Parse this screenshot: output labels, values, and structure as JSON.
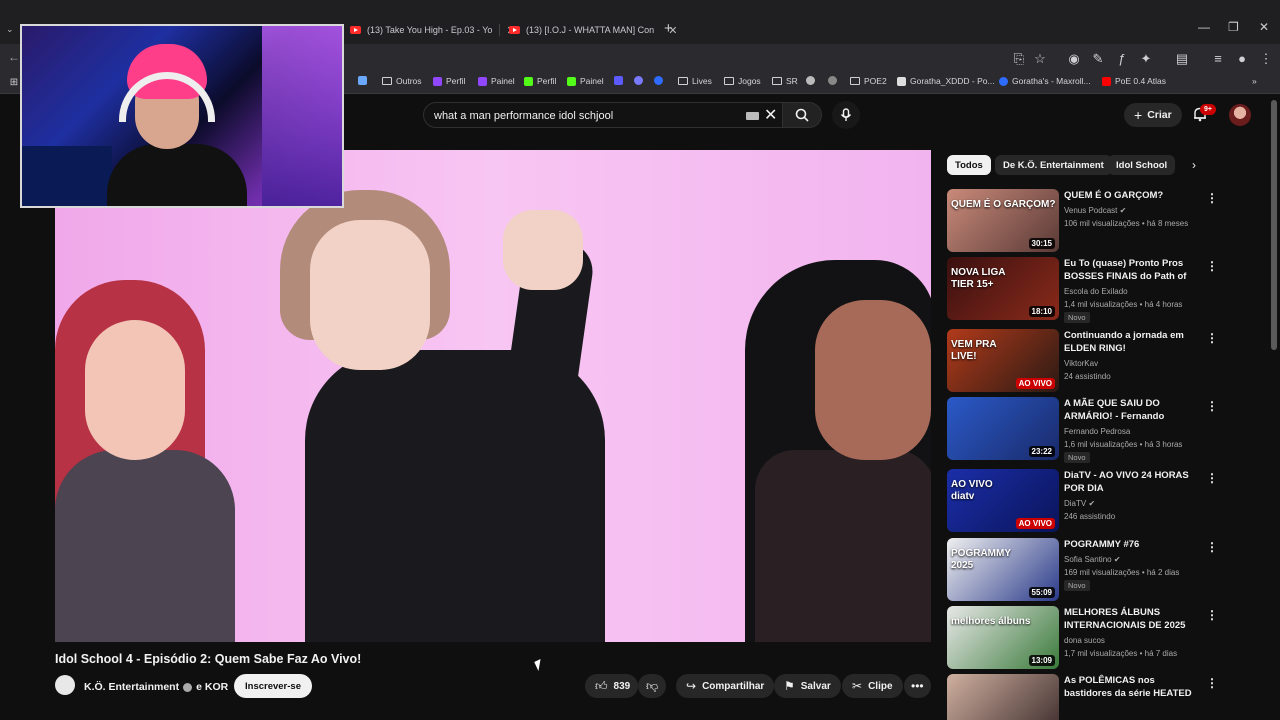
{
  "browser": {
    "tabs": [
      {
        "label": "(13) Take You High - Ep.03 - Yo"
      },
      {
        "label": "(13) [I.O.J - WHATTA MAN] Con"
      }
    ],
    "new_tab": "+",
    "window_controls": [
      "—",
      "❐",
      "✕"
    ],
    "bookmarks": [
      {
        "label": "Outros",
        "icon": "folder-icon"
      },
      {
        "label": "Perfil",
        "icon": "twitch-icon",
        "color": "#9146ff"
      },
      {
        "label": "Painel",
        "icon": "twitch-icon",
        "color": "#9146ff"
      },
      {
        "label": "Perfil",
        "icon": "kick-icon",
        "color": "#53fc18"
      },
      {
        "label": "Painel",
        "icon": "kick-icon",
        "color": "#53fc18"
      },
      {
        "label": "Lives",
        "icon": "folder-icon"
      },
      {
        "label": "Jogos",
        "icon": "folder-icon"
      },
      {
        "label": "SR",
        "icon": "folder-icon"
      },
      {
        "label": "POE2",
        "icon": "folder-icon"
      },
      {
        "label": "Goratha_XDDD - Po...",
        "icon": "car-icon",
        "color": "#dddddd"
      },
      {
        "label": "Goratha's - Maxroll...",
        "icon": "maxroll-icon",
        "color": "#2e6cff"
      },
      {
        "label": "PoE 0.4 Atlas",
        "icon": "youtube-icon",
        "color": "#ff0000"
      }
    ]
  },
  "search": {
    "value": "what a man performance idol schjool"
  },
  "header": {
    "create_label": "Criar",
    "notification_count": "9+"
  },
  "video": {
    "title": "Idol School 4 - Episódio 2: Quem Sabe Faz Ao Vivo!",
    "channel": "K.Ö. Entertainment",
    "collab": "e KOR",
    "subscribe_label": "Inscrever-se",
    "likes": "839",
    "share_label": "Compartilhar",
    "save_label": "Salvar",
    "clip_label": "Clipe"
  },
  "chips": [
    "Todos",
    "De K.Ö. Entertainment",
    "Idol School"
  ],
  "recommendations": [
    {
      "title": "QUEM É O GARÇOM?",
      "channel": "Venus Podcast",
      "verified": true,
      "views": "106 mil visualizações",
      "age": "há 8 meses",
      "duration": "30:15",
      "new": false,
      "thumb_text": "QUEM É O GARÇOM?",
      "colors": [
        "#c98a7a",
        "#5a3a36"
      ]
    },
    {
      "title": "Eu To (quase) Pronto Pros BOSSES FINAIS do Path of Exi...",
      "channel": "Escola do Exilado",
      "verified": false,
      "views": "1,4 mil visualizações",
      "age": "há 4 horas",
      "duration": "18:10",
      "new": true,
      "thumb_text": "NOVA LIGA\nTIER 15+",
      "colors": [
        "#3a1010",
        "#8a2a1a"
      ]
    },
    {
      "title": "Continuando a jornada em ELDEN RING!",
      "channel": "ViktorKav",
      "verified": false,
      "views": "24 assistindo",
      "age": "",
      "duration": "",
      "live": "AO VIVO",
      "new": false,
      "thumb_text": "VEM PRA\nLIVE!",
      "colors": [
        "#b23a1a",
        "#2a1a14"
      ]
    },
    {
      "title": "A MÃE QUE SAIU DO ARMÁRIO! - Fernando Pedrosa - Stand up...",
      "channel": "Fernando Pedrosa",
      "verified": false,
      "views": "1,6 mil visualizações",
      "age": "há 3 horas",
      "duration": "23:22",
      "new": true,
      "thumb_text": "",
      "colors": [
        "#2a5ac8",
        "#1a2a6a"
      ]
    },
    {
      "title": "DiaTV - AO VIVO 24 HORAS POR DIA",
      "channel": "DiaTV",
      "verified": true,
      "views": "246 assistindo",
      "age": "",
      "duration": "",
      "live": "AO VIVO",
      "new": false,
      "thumb_text": "AO VIVO\ndiatv",
      "colors": [
        "#1b2ea8",
        "#0a145a"
      ]
    },
    {
      "title": "POGRAMMY #76",
      "channel": "Sofia Santino",
      "verified": true,
      "views": "169 mil visualizações",
      "age": "há 2 dias",
      "duration": "55:09",
      "new": true,
      "thumb_text": "POGRAMMY\n2025",
      "colors": [
        "#f0f0f0",
        "#2a3a8a"
      ]
    },
    {
      "title": "MELHORES ÁLBUNS INTERNACIONAIS DE 2025",
      "channel": "dona sucos",
      "verified": false,
      "views": "1,7 mil visualizações",
      "age": "há 7 dias",
      "duration": "13:09",
      "new": false,
      "thumb_text": "melhores álbuns",
      "colors": [
        "#e8e8e8",
        "#3a7a3a"
      ]
    },
    {
      "title": "As POLÊMICAS nos bastidores da série HEATED RIVALRY",
      "channel": "",
      "verified": false,
      "views": "",
      "age": "",
      "duration": "",
      "new": false,
      "thumb_text": "",
      "colors": [
        "#d0b0a0",
        "#3a2a2a"
      ]
    }
  ]
}
